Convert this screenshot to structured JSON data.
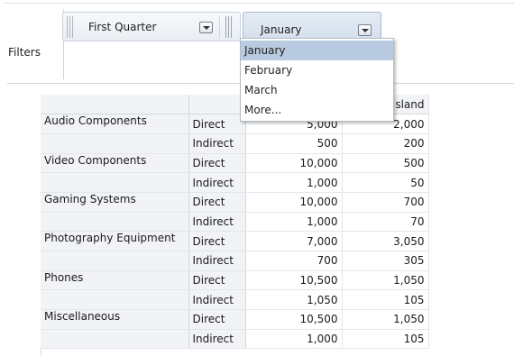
{
  "filters": {
    "label": "Filters",
    "quarter_value": "First Quarter",
    "month_value": "January"
  },
  "dropdown": {
    "options": [
      "January",
      "February",
      "March",
      "More..."
    ],
    "selected": "January"
  },
  "table": {
    "visible_header": "sland",
    "rows": [
      {
        "product": "Audio Components",
        "channel": "Direct",
        "v1": "5,000",
        "v2": "2,000"
      },
      {
        "product": "",
        "channel": "Indirect",
        "v1": "500",
        "v2": "200"
      },
      {
        "product": "Video Components",
        "channel": "Direct",
        "v1": "10,000",
        "v2": "500"
      },
      {
        "product": "",
        "channel": "Indirect",
        "v1": "1,000",
        "v2": "50"
      },
      {
        "product": "Gaming Systems",
        "channel": "Direct",
        "v1": "10,000",
        "v2": "700"
      },
      {
        "product": "",
        "channel": "Indirect",
        "v1": "1,000",
        "v2": "70"
      },
      {
        "product": "Photography Equipment",
        "channel": "Direct",
        "v1": "7,000",
        "v2": "3,050"
      },
      {
        "product": "",
        "channel": "Indirect",
        "v1": "700",
        "v2": "305"
      },
      {
        "product": "Phones",
        "channel": "Direct",
        "v1": "10,500",
        "v2": "1,050"
      },
      {
        "product": "",
        "channel": "Indirect",
        "v1": "1,050",
        "v2": "105"
      },
      {
        "product": "Miscellaneous",
        "channel": "Direct",
        "v1": "10,500",
        "v2": "1,050"
      },
      {
        "product": "",
        "channel": "Indirect",
        "v1": "1,000",
        "v2": "105"
      }
    ]
  }
}
